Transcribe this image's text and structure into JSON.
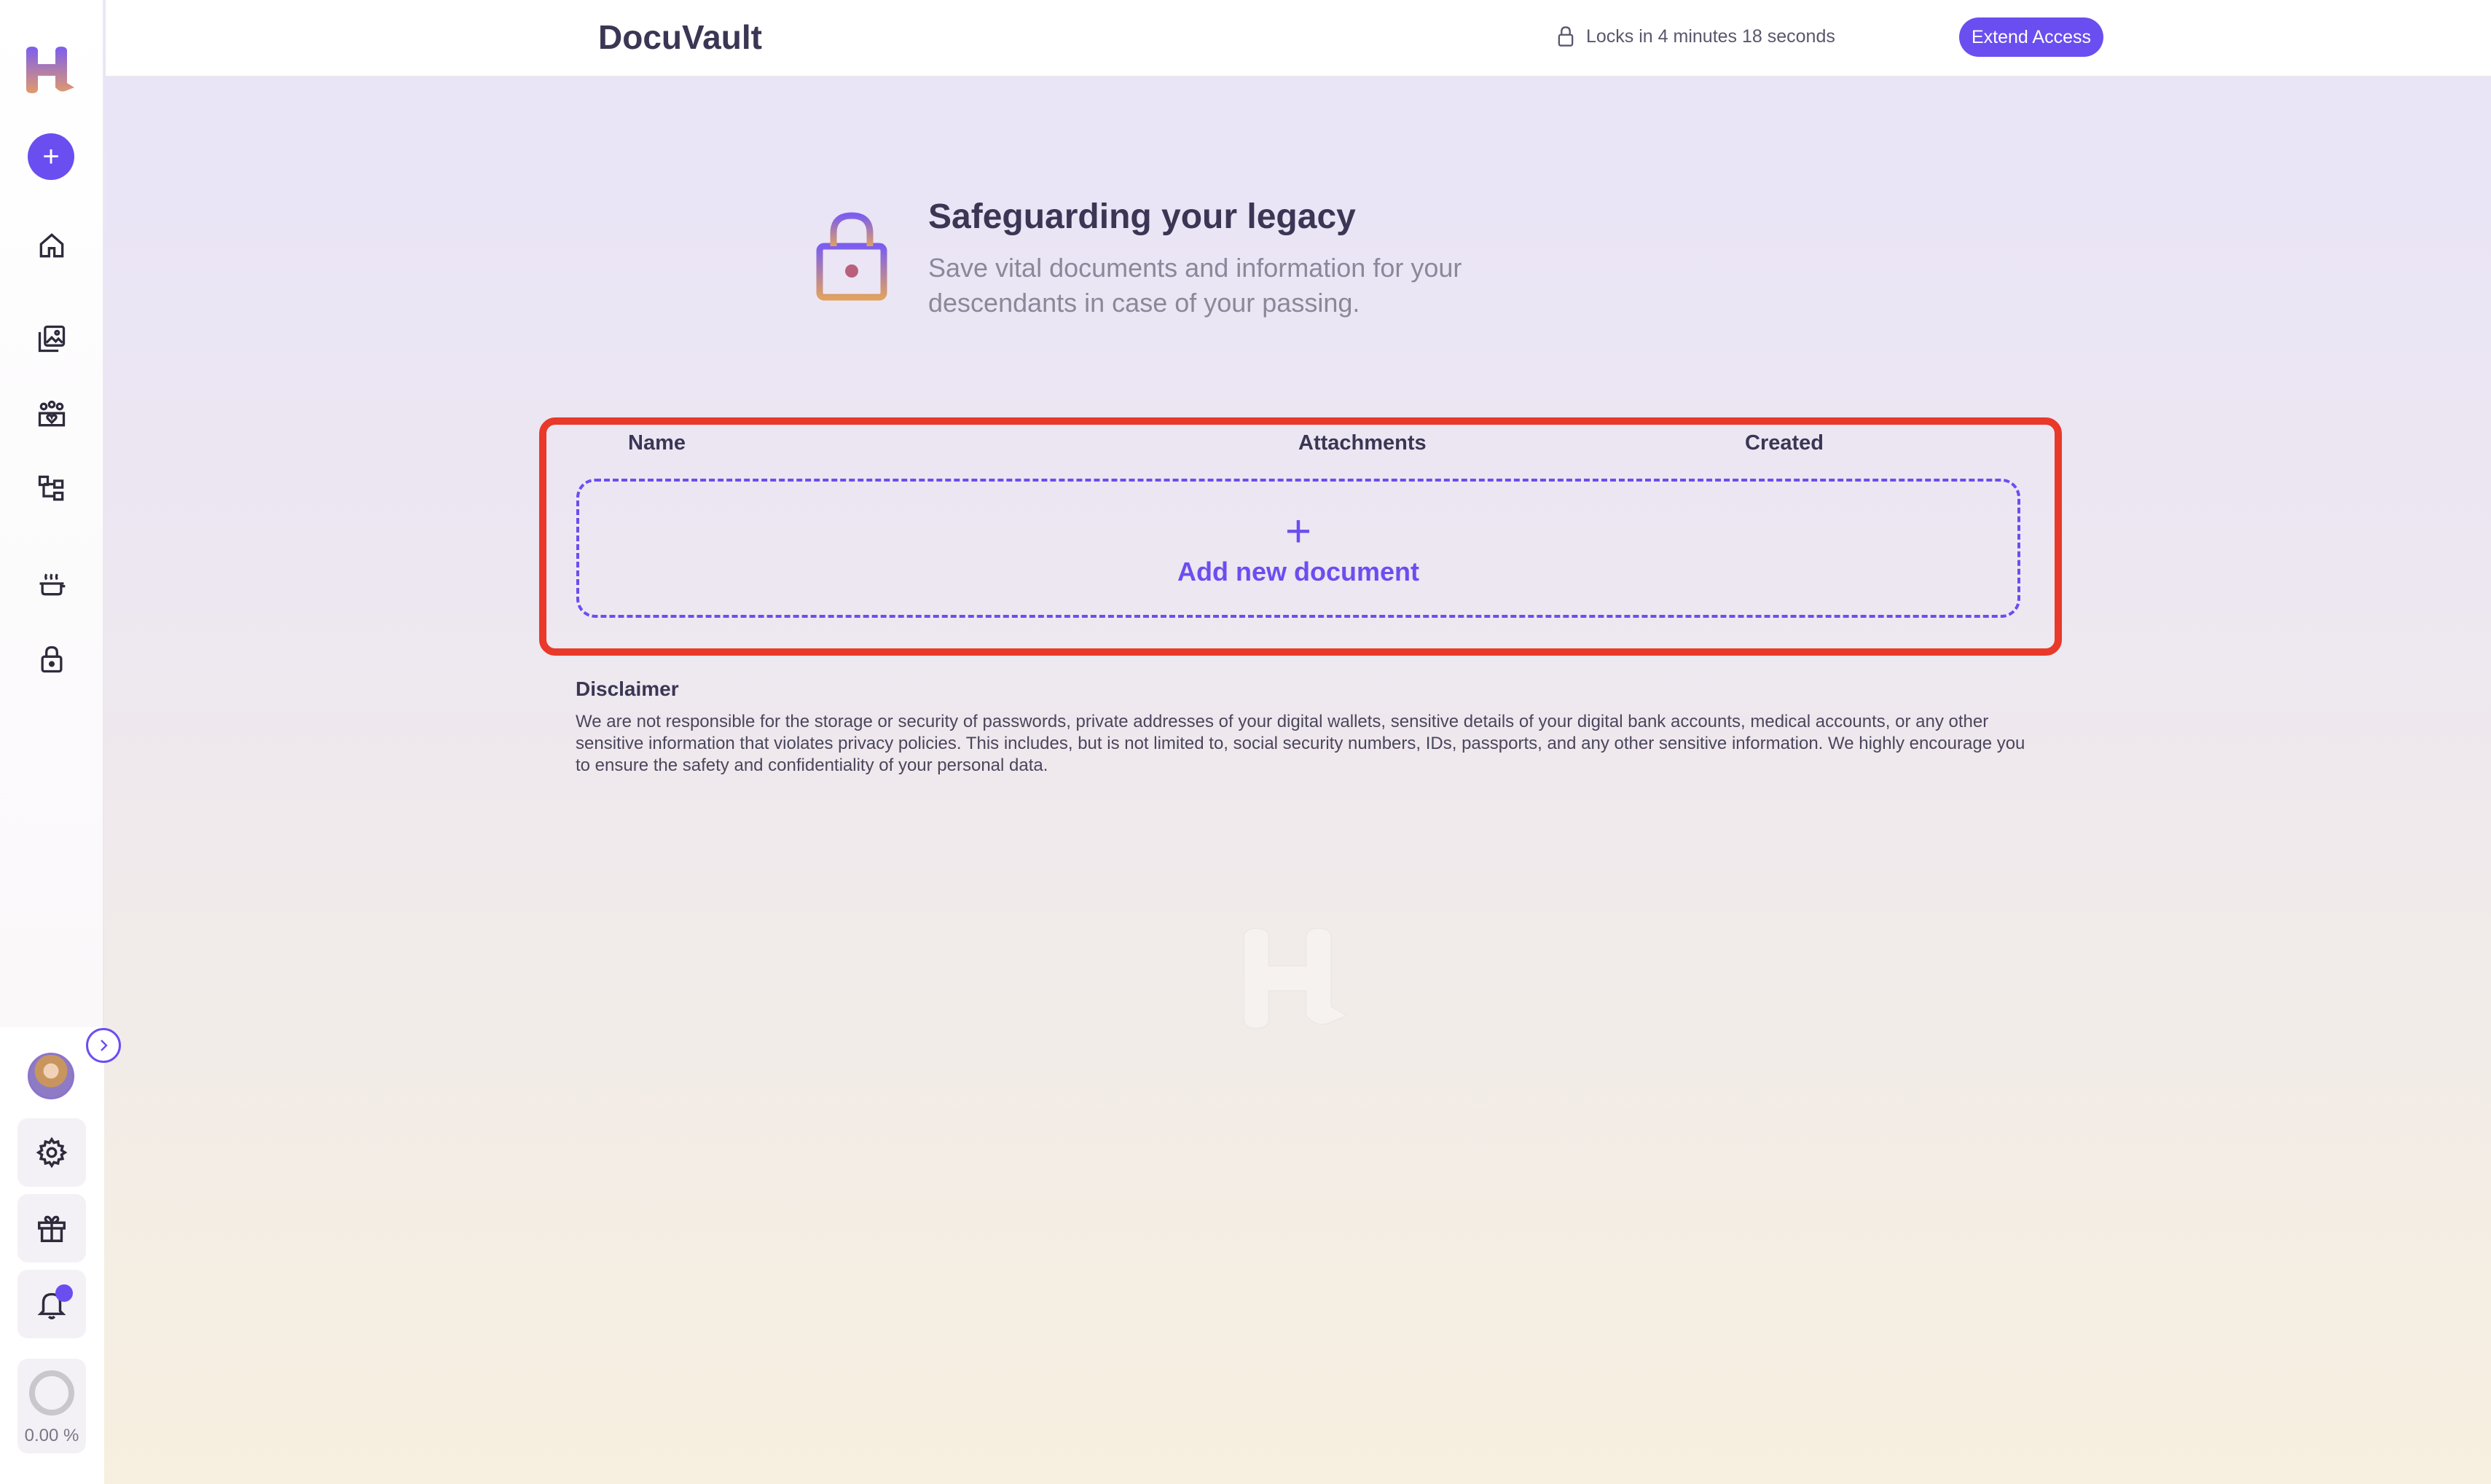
{
  "header": {
    "title": "DocuVault",
    "lock_status": "Locks in 4 minutes 18 seconds",
    "extend_label": "Extend Access"
  },
  "sidebar": {
    "items": [
      {
        "icon": "home-icon"
      },
      {
        "icon": "gallery-icon"
      },
      {
        "icon": "family-icon"
      },
      {
        "icon": "family-tree-icon"
      },
      {
        "icon": "cooking-pot-icon"
      },
      {
        "icon": "lock-icon"
      }
    ],
    "progress": "0.00 %"
  },
  "hero": {
    "title": "Safeguarding your legacy",
    "subtitle": "Save vital documents and information for your descendants in case of your passing."
  },
  "table": {
    "columns": [
      "Name",
      "Attachments",
      "Created"
    ],
    "add_label": "Add new document"
  },
  "disclaimer": {
    "title": "Disclaimer",
    "text": "We are not responsible for the storage or security of passwords, private addresses of your digital wallets, sensitive details of your digital bank accounts, medical accounts, or any other sensitive information that violates privacy policies. This includes, but is not limited to, social security numbers, IDs, passports, and any other sensitive information. We highly encourage you to ensure the safety and confidentiality of your personal data."
  },
  "colors": {
    "accent": "#6b4ef0",
    "highlight": "#e8392a"
  }
}
